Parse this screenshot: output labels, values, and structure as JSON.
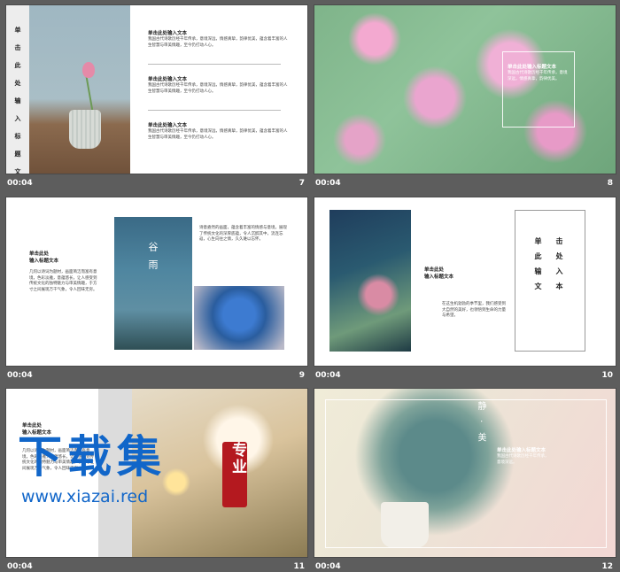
{
  "slides": [
    {
      "time": "00:04",
      "number": "7"
    },
    {
      "time": "00:04",
      "number": "8"
    },
    {
      "time": "00:04",
      "number": "9"
    },
    {
      "time": "00:04",
      "number": "10"
    },
    {
      "time": "00:04",
      "number": "11"
    },
    {
      "time": "00:04",
      "number": "12"
    }
  ],
  "s7": {
    "side_title": "单击此处输入标题文本",
    "heading": "单击此处输入文本",
    "body": "我国古代诗歌历经千年传承，意境深远，情感真挚，韵律优美，蕴含着丰富的人生智慧与审美情趣，至今仍打动人心。"
  },
  "s8": {
    "heading": "单击此处输入标题文本",
    "body": "我国古代诗歌历经千年传承，意境深远，情感真挚，韵律优美。"
  },
  "s9": {
    "heading1": "单击此处",
    "heading2": "输入标题文本",
    "body": "几何以诗词为题材，画面简洁而富有意境，色彩淡雅，意蕴悠长，让人感受到传统文化的独特魅力与审美情趣，于方寸之间展现万千气象，令人回味无穷。",
    "right_body": "诗意盎然的画面，蕴含着丰富的情感与意境，展现了传统文化的深厚底蕴，令人沉醉其中，流连忘返，心生向往之情，久久难以忘怀。",
    "poster_title": "谷雨"
  },
  "s10": {
    "heading1": "单击此处",
    "heading2": "输入标题文本",
    "body": "在这生机勃勃的季节里，我们感受到大自然的美好，也领悟到生命的力量与希望。",
    "col1": "单此输文",
    "col2": "击处入本"
  },
  "s11": {
    "heading1": "单击此处",
    "heading2": "输入标题文本",
    "body": "几何以诗词为题材，画面简洁而富有意境，色彩淡雅，意蕴悠长，让人感受到传统文化的独特魅力与审美情趣，于方寸之间展现万千气象，令人回味无穷。",
    "seal": "专业"
  },
  "s12": {
    "heading": "单击此处输入标题文本",
    "body": "我国古代诗歌历经千年传承，意境深远。",
    "vertical": "静 · 美"
  },
  "watermark": {
    "title": "下载集",
    "url": "www.xiazai.red"
  }
}
